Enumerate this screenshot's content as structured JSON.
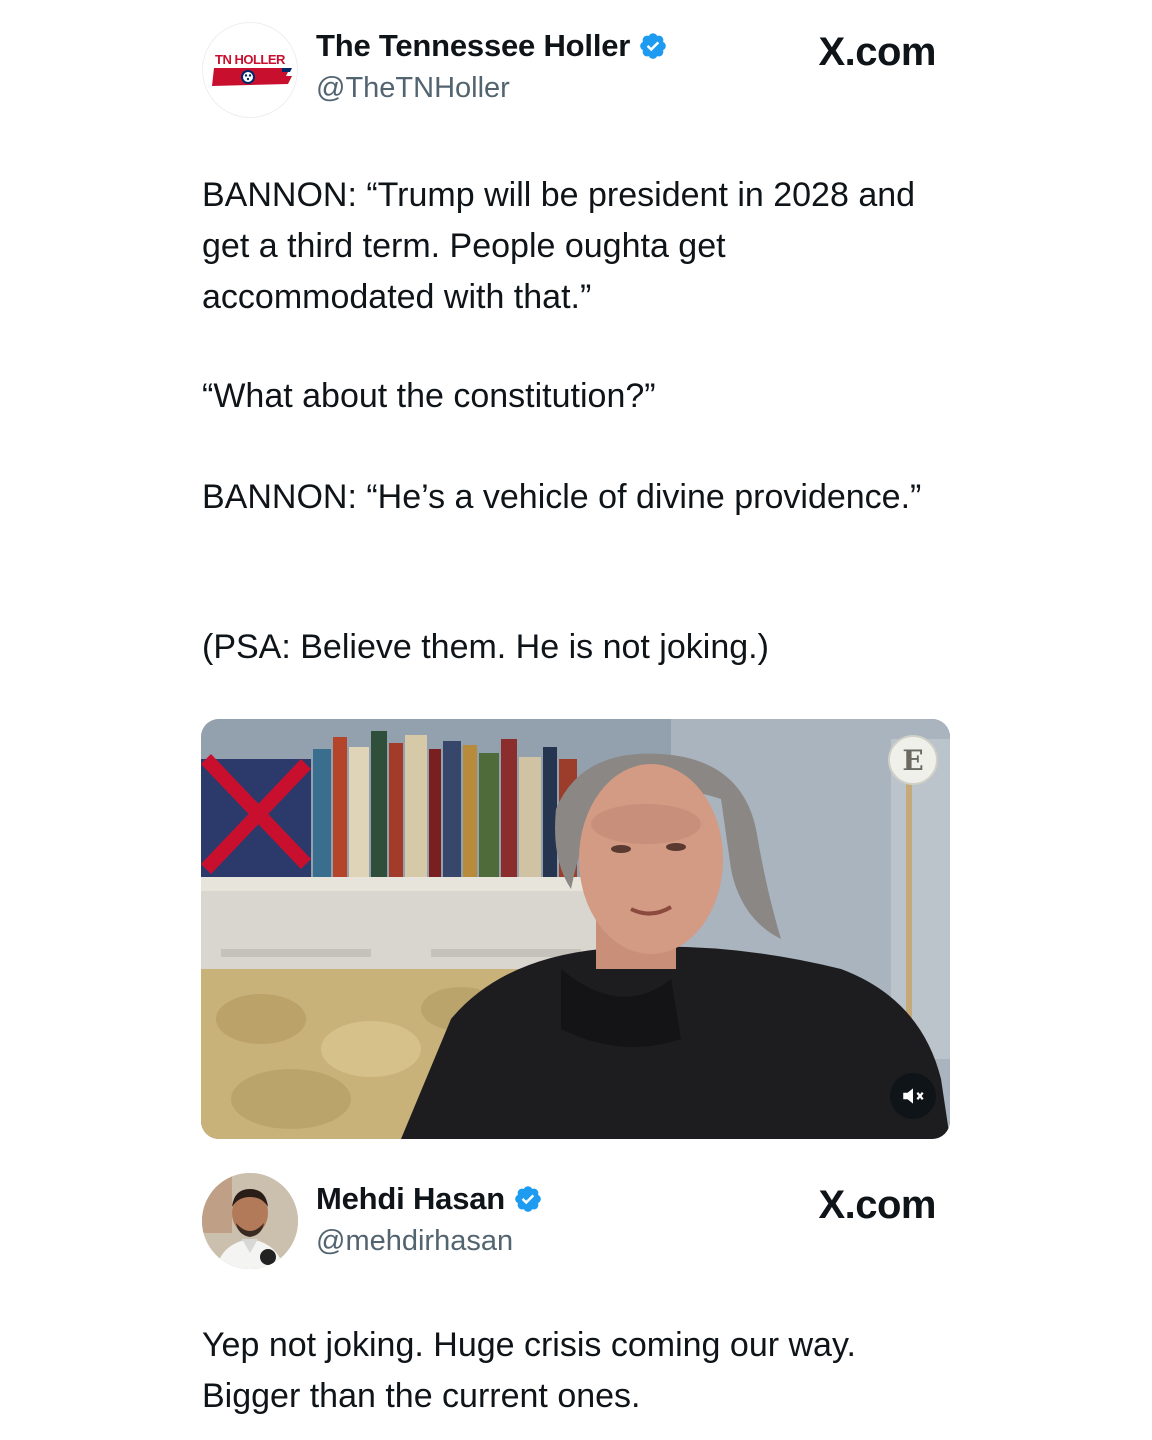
{
  "colors": {
    "verified": "#1d9bf0",
    "text": "#0f1419",
    "secondary": "#536471"
  },
  "tweet1": {
    "avatar_logo_text": "TN HOLLER",
    "name": "The Tennessee Holler",
    "handle": "@TheTNHoller",
    "source": "X.com",
    "paragraphs": [
      "BANNON: “Trump will be president in 2028 and get a third term. People oughta get accommodated with that.”",
      "“What about the constitution?”",
      "BANNON: “He’s a vehicle of divine providence.”",
      "(PSA: Believe them. He is not joking.)"
    ],
    "video": {
      "badge": "E",
      "mute_icon": "speaker-muted-icon"
    }
  },
  "tweet2": {
    "name": "Mehdi Hasan",
    "handle": "@mehdirhasan",
    "source": "X.com",
    "text": "Yep not joking. Huge crisis coming our way. Bigger than the current ones."
  }
}
